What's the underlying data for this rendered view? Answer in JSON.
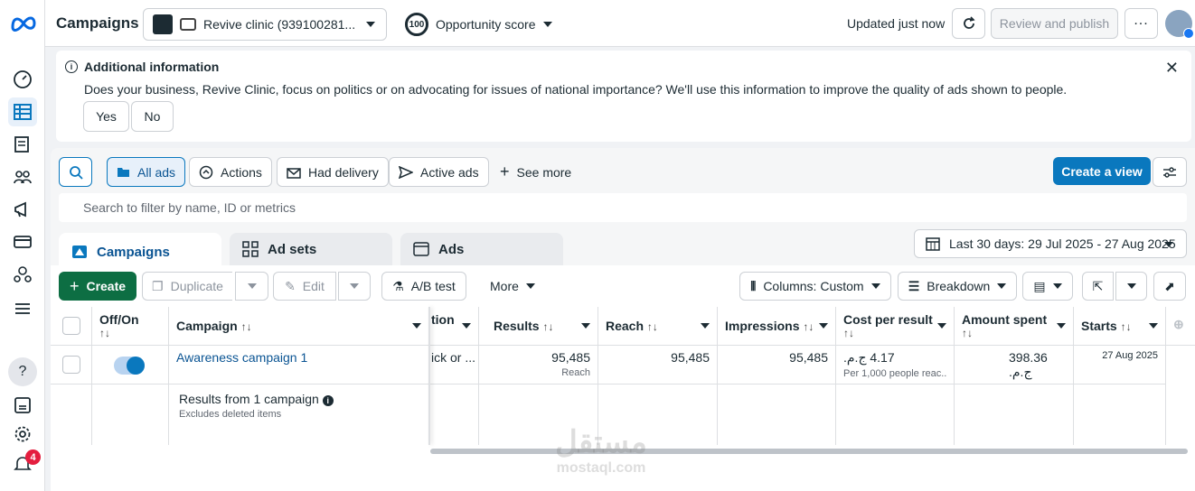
{
  "topbar": {
    "title": "Campaigns",
    "account_name": "Revive clinic (939100281...",
    "opportunity_score_value": "100",
    "opportunity_score_label": "Opportunity score",
    "updated": "Updated just now",
    "review_publish": "Review and publish"
  },
  "banner": {
    "title": "Additional information",
    "body": "Does your business, Revive Clinic, focus on politics or on advocating for issues of national importance? We'll use this information to improve the quality of ads shown to people.",
    "yes": "Yes",
    "no": "No"
  },
  "filters": {
    "all_ads": "All ads",
    "actions": "Actions",
    "had_delivery": "Had delivery",
    "active_ads": "Active ads",
    "see_more": "See more",
    "create_view": "Create a view",
    "search_placeholder": "Search to filter by name, ID or metrics"
  },
  "tabs": {
    "campaigns": "Campaigns",
    "ad_sets": "Ad sets",
    "ads": "Ads"
  },
  "date_range": "Last 30 days: 29 Jul 2025 - 27 Aug 2025",
  "toolbar": {
    "create": "Create",
    "duplicate": "Duplicate",
    "edit": "Edit",
    "ab_test": "A/B test",
    "more": "More",
    "columns": "Columns: Custom",
    "breakdown": "Breakdown"
  },
  "table": {
    "headers": {
      "off_on": "Off/On",
      "campaign": "Campaign",
      "attribution": "tion",
      "results": "Results",
      "reach": "Reach",
      "impressions": "Impressions",
      "cost_per_result": "Cost per result",
      "amount_spent": "Amount spent",
      "starts": "Starts",
      "sort_glyph": "↑↓"
    },
    "row": {
      "campaign": "Awareness campaign 1",
      "attribution": "ick or ...",
      "results": "95,485",
      "results_sub": "Reach",
      "reach": "95,485",
      "impressions": "95,485",
      "cost_per_result": "4.17 ج.م.",
      "cost_per_result_sub": "Per 1,000 people reac...",
      "amount_spent": "398.36 ج.م.",
      "starts": "27 Aug 2025",
      "toggle_on": true
    },
    "summary": {
      "title": "Results from 1 campaign",
      "sub": "Excludes deleted items"
    }
  },
  "notifications_count": "4",
  "watermark": {
    "arabic": "مستقل",
    "latin": "mostaql.com"
  }
}
